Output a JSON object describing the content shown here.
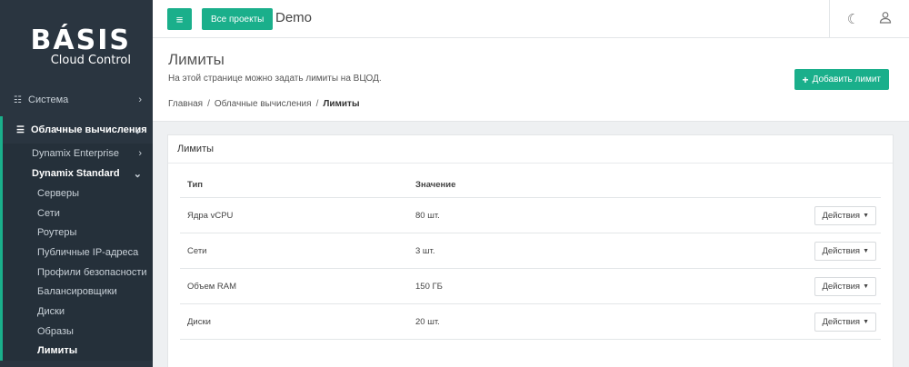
{
  "logo": {
    "main": "BÁSIS",
    "sub": "Cloud Control"
  },
  "sidebar": {
    "system": {
      "label": "Система",
      "icon": "sitemap-icon"
    },
    "cloud": {
      "label": "Облачные вычисления",
      "icon": "server-icon"
    },
    "enterprise": {
      "label": "Dynamix Enterprise"
    },
    "standard": {
      "label": "Dynamix Standard"
    },
    "items": [
      {
        "label": "Серверы"
      },
      {
        "label": "Сети"
      },
      {
        "label": "Роутеры"
      },
      {
        "label": "Публичные IP-адреса"
      },
      {
        "label": "Профили безопасности"
      },
      {
        "label": "Балансировщики"
      },
      {
        "label": "Диски"
      },
      {
        "label": "Образы"
      },
      {
        "label": "Лимиты"
      }
    ]
  },
  "topbar": {
    "menu_icon": "≡",
    "projects_label": "Все проекты",
    "project_name": "Demo",
    "theme_icon": "moon-icon",
    "user_icon": "user-icon"
  },
  "header": {
    "title": "Лимиты",
    "description": "На этой странице можно задать лимиты на ВЦОД.",
    "add_button": "Добавить лимит",
    "breadcrumb": [
      "Главная",
      "Облачные вычисления",
      "Лимиты"
    ]
  },
  "panel": {
    "title": "Лимиты",
    "columns": [
      "Тип",
      "Значение"
    ],
    "rows": [
      {
        "type": "Ядра vCPU",
        "value": "80 шт.",
        "action": "Действия"
      },
      {
        "type": "Сети",
        "value": "3 шт.",
        "action": "Действия"
      },
      {
        "type": "Объем RAM",
        "value": "150 ГБ",
        "action": "Действия"
      },
      {
        "type": "Диски",
        "value": "20 шт.",
        "action": "Действия"
      }
    ]
  },
  "colors": {
    "accent": "#1aaf8b",
    "sidebar_bg": "#2a3540"
  }
}
